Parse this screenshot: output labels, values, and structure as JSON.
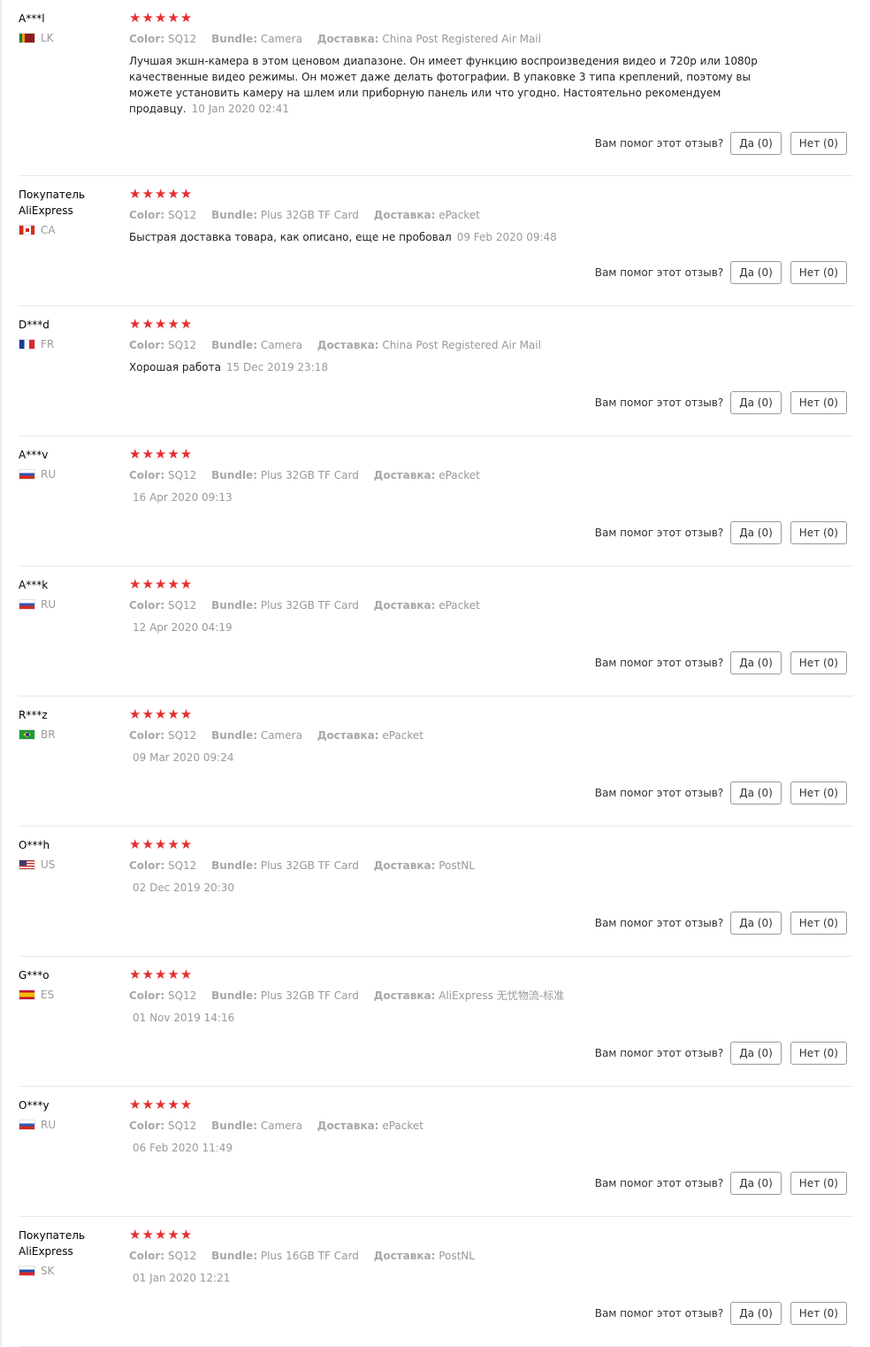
{
  "helpful_prompt": "Вам помог этот отзыв?",
  "attr_labels": {
    "color": "Color:",
    "bundle": "Bundle:",
    "shipping": "Доставка:"
  },
  "star_color": "#e62e2e",
  "reviews": [
    {
      "name": "A***l",
      "country": "LK",
      "flag_icon": "sri-lanka-flag-icon",
      "stars": "★★★★★",
      "color": "SQ12",
      "bundle": "Camera",
      "shipping": "China Post Registered Air Mail",
      "text": "Лучшая экшн-камера в этом ценовом диапазоне. Он имеет функцию воспроизведения видео и 720p или 1080p качественные видео режимы. Он может даже делать фотографии. В упаковке 3 типа креплений, поэтому вы можете установить камеру на шлем или приборную панель или что угодно. Настоятельно рекомендуем продавцу.",
      "date": "10 Jan 2020 02:41",
      "yes": "Да (0)",
      "no": "Нет (0)"
    },
    {
      "name": "Покупатель AliExpress",
      "country": "CA",
      "flag_icon": "canada-flag-icon",
      "stars": "★★★★★",
      "color": "SQ12",
      "bundle": "Plus 32GB TF Card",
      "shipping": "ePacket",
      "text": "Быстрая доставка товара, как описано, еще не пробовал",
      "date": "09 Feb 2020 09:48",
      "yes": "Да (0)",
      "no": "Нет (0)"
    },
    {
      "name": "D***d",
      "country": "FR",
      "flag_icon": "france-flag-icon",
      "stars": "★★★★★",
      "color": "SQ12",
      "bundle": "Camera",
      "shipping": "China Post Registered Air Mail",
      "text": "Хорошая работа",
      "date": "15 Dec 2019 23:18",
      "yes": "Да (0)",
      "no": "Нет (0)"
    },
    {
      "name": "A***v",
      "country": "RU",
      "flag_icon": "russia-flag-icon",
      "stars": "★★★★★",
      "color": "SQ12",
      "bundle": "Plus 32GB TF Card",
      "shipping": "ePacket",
      "text": "",
      "date": "16 Apr 2020 09:13",
      "yes": "Да (0)",
      "no": "Нет (0)"
    },
    {
      "name": "A***k",
      "country": "RU",
      "flag_icon": "russia-flag-icon",
      "stars": "★★★★★",
      "color": "SQ12",
      "bundle": "Plus 32GB TF Card",
      "shipping": "ePacket",
      "text": "",
      "date": "12 Apr 2020 04:19",
      "yes": "Да (0)",
      "no": "Нет (0)"
    },
    {
      "name": "R***z",
      "country": "BR",
      "flag_icon": "brazil-flag-icon",
      "stars": "★★★★★",
      "color": "SQ12",
      "bundle": "Camera",
      "shipping": "ePacket",
      "text": "",
      "date": "09 Mar 2020 09:24",
      "yes": "Да (0)",
      "no": "Нет (0)"
    },
    {
      "name": "O***h",
      "country": "US",
      "flag_icon": "usa-flag-icon",
      "stars": "★★★★★",
      "color": "SQ12",
      "bundle": "Plus 32GB TF Card",
      "shipping": "PostNL",
      "text": "",
      "date": "02 Dec 2019 20:30",
      "yes": "Да (0)",
      "no": "Нет (0)"
    },
    {
      "name": "G***o",
      "country": "ES",
      "flag_icon": "spain-flag-icon",
      "stars": "★★★★★",
      "color": "SQ12",
      "bundle": "Plus 32GB TF Card",
      "shipping": "AliExpress 无忧物流-标准",
      "text": "",
      "date": "01 Nov 2019 14:16",
      "yes": "Да (0)",
      "no": "Нет (0)"
    },
    {
      "name": "O***y",
      "country": "RU",
      "flag_icon": "russia-flag-icon",
      "stars": "★★★★★",
      "color": "SQ12",
      "bundle": "Camera",
      "shipping": "ePacket",
      "text": "",
      "date": "06 Feb 2020 11:49",
      "yes": "Да (0)",
      "no": "Нет (0)"
    },
    {
      "name": "Покупатель AliExpress",
      "country": "SK",
      "flag_icon": "slovakia-flag-icon",
      "stars": "★★★★★",
      "color": "SQ12",
      "bundle": "Plus 16GB TF Card",
      "shipping": "PostNL",
      "text": "",
      "date": "01 Jan 2020 12:21",
      "yes": "Да (0)",
      "no": "Нет (0)"
    }
  ]
}
